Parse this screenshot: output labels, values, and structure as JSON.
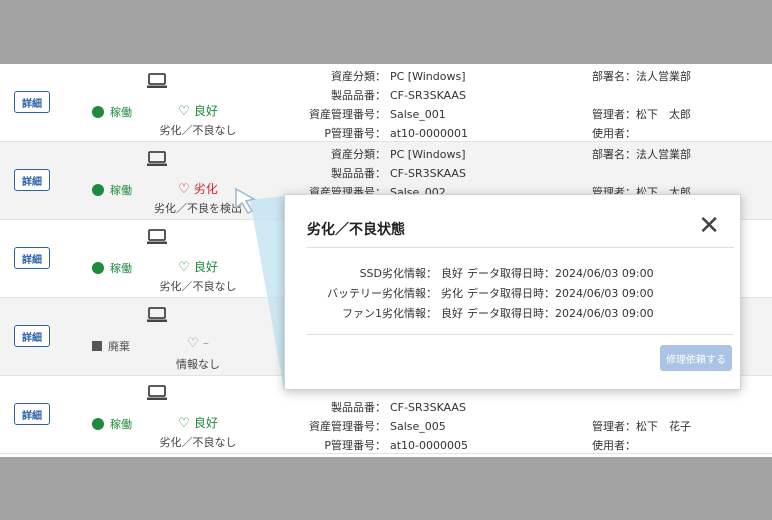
{
  "rows": [
    {
      "detail": "詳細",
      "status": "稼働",
      "status_kind": "active",
      "health": "良好",
      "health_kind": "good",
      "health_sub": "劣化／不良なし",
      "info": [
        {
          "label": "資産分類：",
          "value": "PC [Windows]"
        },
        {
          "label": "製品品番：",
          "value": "CF-SR3SKAAS"
        },
        {
          "label": "資産管理番号：",
          "value": "Salse_001"
        },
        {
          "label": "P管理番号：",
          "value": "at10-0000001"
        }
      ],
      "org": [
        {
          "label": "部署名：",
          "value": "法人営業部"
        },
        {
          "label": "",
          "value": ""
        },
        {
          "label": "管理者：",
          "value": "松下　太郎"
        },
        {
          "label": "使用者：",
          "value": ""
        }
      ]
    },
    {
      "detail": "詳細",
      "status": "稼働",
      "status_kind": "active",
      "health": "劣化",
      "health_kind": "bad",
      "health_sub": "劣化／不良を検出",
      "info": [
        {
          "label": "資産分類：",
          "value": "PC [Windows]"
        },
        {
          "label": "製品品番：",
          "value": "CF-SR3SKAAS"
        },
        {
          "label": "資産管理番号：",
          "value": "Salse_002"
        }
      ],
      "org": [
        {
          "label": "部署名：",
          "value": "法人営業部"
        },
        {
          "label": "",
          "value": ""
        },
        {
          "label": "管理者：",
          "value": "松下　太郎"
        }
      ]
    },
    {
      "detail": "詳細",
      "status": "稼働",
      "status_kind": "active",
      "health": "良好",
      "health_kind": "good",
      "health_sub": "劣化／不良なし",
      "info": [],
      "org": []
    },
    {
      "detail": "詳細",
      "status": "廃棄",
      "status_kind": "disposed",
      "health": "–",
      "health_kind": "none",
      "health_sub": "情報なし",
      "info": [],
      "org": []
    },
    {
      "detail": "詳細",
      "status": "稼働",
      "status_kind": "active",
      "health": "良好",
      "health_kind": "good",
      "health_sub": "劣化／不良なし",
      "info": [
        {
          "label": "",
          "value": ""
        },
        {
          "label": "製品品番：",
          "value": "CF-SR3SKAAS"
        },
        {
          "label": "資産管理番号：",
          "value": "Salse_005"
        },
        {
          "label": "P管理番号：",
          "value": "at10-0000005"
        }
      ],
      "org": [
        {
          "label": "",
          "value": ""
        },
        {
          "label": "",
          "value": ""
        },
        {
          "label": "管理者：",
          "value": "松下　花子"
        },
        {
          "label": "使用者：",
          "value": ""
        }
      ]
    }
  ],
  "popup": {
    "title": "劣化／不良状態",
    "close": "✕",
    "items": [
      {
        "label": "SSD劣化情報：",
        "value": "良好",
        "date_label": "データ取得日時：",
        "date": "2024/06/03 09:00"
      },
      {
        "label": "バッテリー劣化情報：",
        "value": "劣化",
        "date_label": "データ取得日時：",
        "date": "2024/06/03 09:00"
      },
      {
        "label": "ファン1劣化情報：",
        "value": "良好",
        "date_label": "データ取得日時：",
        "date": "2024/06/03 09:00"
      }
    ],
    "repair_button": "修理依頼する"
  },
  "colors": {
    "active": "#1e8a3c",
    "bad": "#d2232a",
    "accent": "#2d62a8",
    "repair": "#a9c4e4"
  },
  "icons": {
    "device": "laptop-icon",
    "good": "heart-icon",
    "bad": "broken-heart-icon",
    "close": "close-icon"
  }
}
